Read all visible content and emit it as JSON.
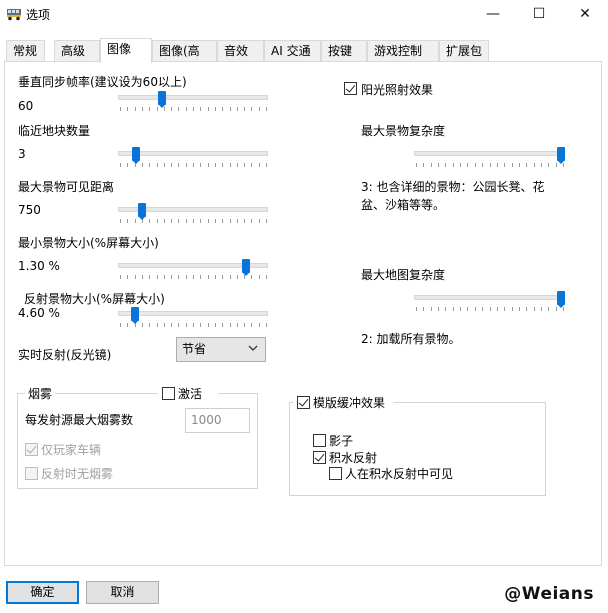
{
  "window": {
    "title": "选项",
    "minimize_glyph": "—",
    "maximize_glyph": "☐",
    "close_glyph": "✕"
  },
  "tabs": [
    {
      "label": "常规"
    },
    {
      "label": "高级"
    },
    {
      "label": "图像",
      "active": true
    },
    {
      "label": "图像(高级)"
    },
    {
      "label": "音效"
    },
    {
      "label": "AI 交通"
    },
    {
      "label": "按键"
    },
    {
      "label": "游戏控制器"
    },
    {
      "label": "扩展包"
    }
  ],
  "left": {
    "vsync": {
      "label": "垂直同步帧率(建议设为60以上)",
      "value": "60",
      "position": 0.28
    },
    "nearby_blocks": {
      "label": "临近地块数量",
      "value": "3",
      "position": 0.1
    },
    "max_scenery_distance": {
      "label": "最大景物可见距离",
      "value": "750",
      "position": 0.14
    },
    "min_scenery_size": {
      "label": "最小景物大小(%屏幕大小)",
      "value": "1.30 %",
      "position": 0.87
    },
    "reflect_scenery_size": {
      "label": "反射景物大小(%屏幕大小)",
      "value": "4.60 %",
      "position": 0.09
    },
    "realtime_reflection": {
      "label": "实时反射(反光镜)",
      "selected": "节省"
    }
  },
  "right": {
    "sun_effect": {
      "label": "阳光照射效果",
      "checked": true
    },
    "max_scenery_complexity": {
      "label": "最大景物复杂度",
      "position": 1.0,
      "description": "3: 也含详细的景物：公园长凳、花盆、沙箱等等。"
    },
    "max_map_complexity": {
      "label": "最大地图复杂度",
      "position": 1.0,
      "description": "2: 加载所有景物。"
    }
  },
  "smoke": {
    "group_title": "烟雾",
    "activate_label": "激活",
    "activate_checked": false,
    "max_smoke_label": "每发射源最大烟雾数",
    "max_smoke_value": "1000",
    "player_only_label": "仅玩家车辆",
    "player_only_checked": true,
    "no_smoke_reflection_label": "反射时无烟雾",
    "no_smoke_reflection_checked": false
  },
  "stencil": {
    "group_title": "模版缓冲效果",
    "group_checked": true,
    "shadows_label": "影子",
    "shadows_checked": false,
    "puddle_label": "积水反射",
    "puddle_checked": true,
    "people_in_puddle_label": "人在积水反射中可见",
    "people_in_puddle_checked": false
  },
  "footer": {
    "ok_label": "确定",
    "cancel_label": "取消",
    "watermark": "@Weians"
  }
}
